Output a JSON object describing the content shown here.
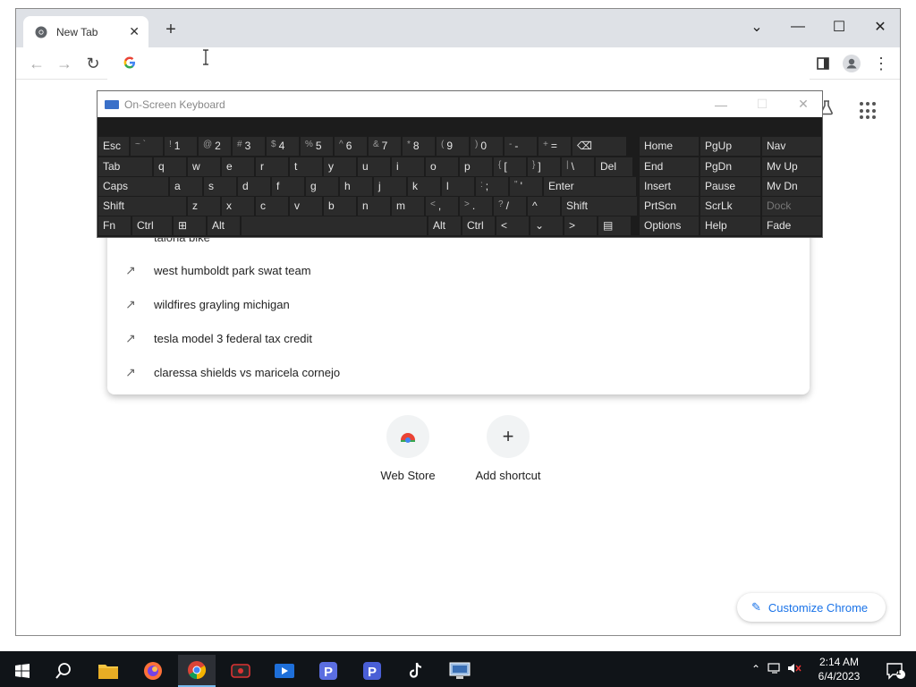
{
  "browser": {
    "tab_title": "New Tab",
    "tab_close": "✕",
    "new_tab": "+",
    "win_controls": {
      "minimize": "—",
      "maximize": "☐",
      "close": "✕",
      "dropdown": "⌄"
    },
    "nav": {
      "back": "←",
      "forward": "→",
      "reload": "↻"
    },
    "omnibox_logo": "G",
    "toolbar_more": "⋮"
  },
  "page": {
    "top_suggestion": "taiona bike",
    "suggestions": [
      "west humboldt park swat team",
      "wildfires grayling michigan",
      "tesla model 3 federal tax credit",
      "claressa shields vs maricela cornejo"
    ],
    "shortcuts": [
      {
        "label": "Web Store",
        "icon": "chrome-webstore-icon"
      },
      {
        "label": "Add shortcut",
        "icon": "plus-icon",
        "glyph": "+"
      }
    ],
    "customize_label": "Customize Chrome"
  },
  "osk": {
    "title": "On-Screen Keyboard",
    "controls": {
      "minimize": "—",
      "maximize": "☐",
      "close": "✕"
    },
    "rows": [
      [
        {
          "l": "Esc"
        },
        {
          "s": "~ `",
          "l": ""
        },
        {
          "s": "!",
          "l": "1"
        },
        {
          "s": "@",
          "l": "2"
        },
        {
          "s": "#",
          "l": "3"
        },
        {
          "s": "$",
          "l": "4"
        },
        {
          "s": "%",
          "l": "5"
        },
        {
          "s": "^",
          "l": "6"
        },
        {
          "s": "&",
          "l": "7"
        },
        {
          "s": "*",
          "l": "8"
        },
        {
          "s": "(",
          "l": "9"
        },
        {
          "s": ")",
          "l": "0"
        },
        {
          "s": "-",
          "l": "-"
        },
        {
          "s": "+",
          "l": "="
        },
        {
          "l": "⌫"
        }
      ],
      [
        {
          "l": "Tab"
        },
        {
          "l": "q"
        },
        {
          "l": "w"
        },
        {
          "l": "e"
        },
        {
          "l": "r"
        },
        {
          "l": "t"
        },
        {
          "l": "y"
        },
        {
          "l": "u"
        },
        {
          "l": "i"
        },
        {
          "l": "o"
        },
        {
          "l": "p"
        },
        {
          "s": "{",
          "l": "["
        },
        {
          "s": "}",
          "l": "]"
        },
        {
          "s": "|",
          "l": "\\"
        },
        {
          "l": "Del"
        }
      ],
      [
        {
          "l": "Caps"
        },
        {
          "l": "a"
        },
        {
          "l": "s"
        },
        {
          "l": "d"
        },
        {
          "l": "f"
        },
        {
          "l": "g"
        },
        {
          "l": "h"
        },
        {
          "l": "j"
        },
        {
          "l": "k"
        },
        {
          "l": "l"
        },
        {
          "s": ":",
          "l": ";"
        },
        {
          "s": "\"",
          "l": "'"
        },
        {
          "l": "Enter"
        }
      ],
      [
        {
          "l": "Shift"
        },
        {
          "l": "z"
        },
        {
          "l": "x"
        },
        {
          "l": "c"
        },
        {
          "l": "v"
        },
        {
          "l": "b"
        },
        {
          "l": "n"
        },
        {
          "l": "m"
        },
        {
          "s": "<",
          "l": ","
        },
        {
          "s": ">",
          "l": "."
        },
        {
          "s": "?",
          "l": "/"
        },
        {
          "l": "^"
        },
        {
          "l": "Shift"
        }
      ],
      [
        {
          "l": "Fn"
        },
        {
          "l": "Ctrl"
        },
        {
          "l": "⊞"
        },
        {
          "l": "Alt"
        },
        {
          "l": ""
        },
        {
          "l": "Alt"
        },
        {
          "l": "Ctrl"
        },
        {
          "l": "<"
        },
        {
          "l": "⌄"
        },
        {
          "l": ">"
        },
        {
          "l": "▤"
        }
      ]
    ],
    "nav_keys": [
      [
        "Home",
        "PgUp",
        "Nav"
      ],
      [
        "End",
        "PgDn",
        "Mv Up"
      ],
      [
        "Insert",
        "Pause",
        "Mv Dn"
      ],
      [
        "PrtScn",
        "ScrLk",
        "Dock"
      ],
      [
        "Options",
        "Help",
        "Fade"
      ]
    ]
  },
  "taskbar": {
    "apps": [
      "windows-start-icon",
      "search-icon",
      "file-explorer-icon",
      "firefox-icon",
      "chrome-icon",
      "camera-app-icon",
      "media-player-icon",
      "p-app-icon",
      "p-app-icon-2",
      "tiktok-icon",
      "remote-desktop-icon"
    ],
    "time": "2:14 AM",
    "date": "6/4/2023",
    "notification_count": "1"
  },
  "colors": {
    "accent": "#1a73e8",
    "osk_bg": "#1c1c1c",
    "osk_key": "#2b2b2b",
    "taskbar": "#101418"
  }
}
